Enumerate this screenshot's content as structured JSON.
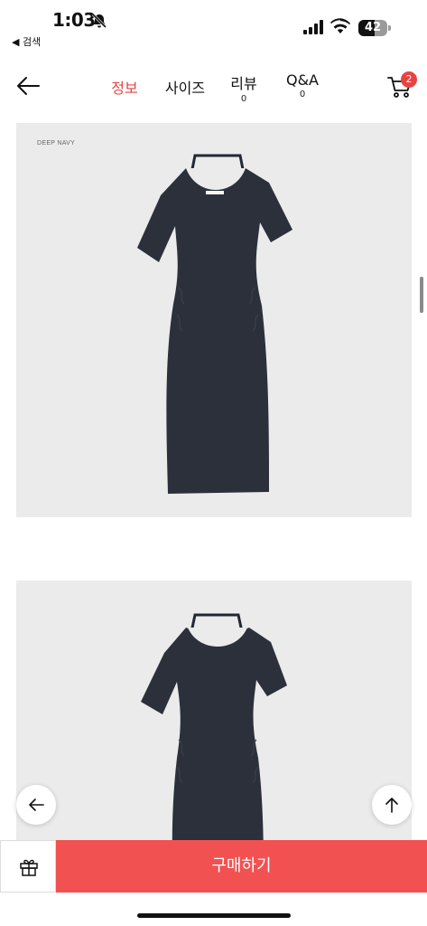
{
  "status_bar": {
    "time": "1:03",
    "back_app_label": "◀ 검색",
    "battery": "42"
  },
  "header": {
    "tabs": [
      {
        "label": "정보",
        "count": ""
      },
      {
        "label": "사이즈",
        "count": ""
      },
      {
        "label": "리뷰",
        "count": "0"
      },
      {
        "label": "Q&A",
        "count": "0"
      }
    ],
    "active_tab": "정보",
    "cart_count": "2"
  },
  "product": {
    "panel_1_label": "DEEP NAVY"
  },
  "bottom_bar": {
    "buy_label": "구매하기"
  },
  "colors": {
    "accent": "#f25151",
    "active_tab": "#e84343",
    "dress": "#2b303b",
    "image_bg": "#ebebeb"
  }
}
